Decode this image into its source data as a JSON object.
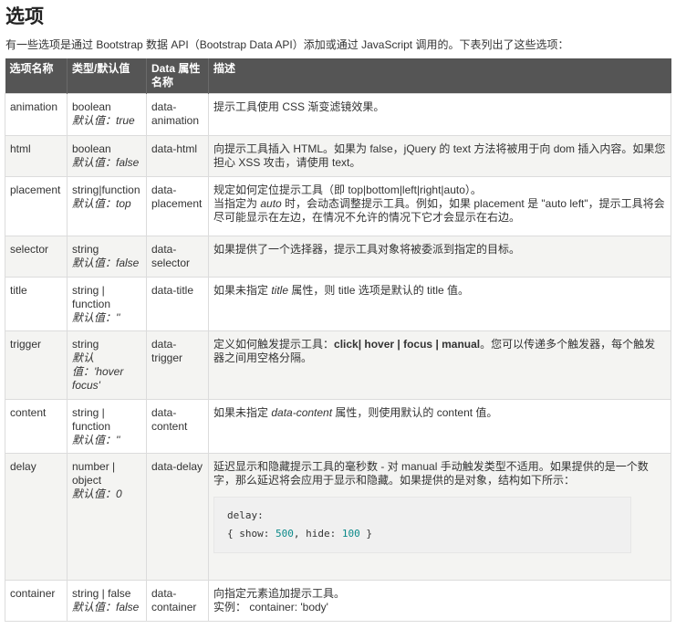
{
  "page": {
    "title": "选项",
    "intro": "有一些选项是通过 Bootstrap 数据 API（Bootstrap Data API）添加或通过 JavaScript 调用的。下表列出了这些选项："
  },
  "table": {
    "headers": [
      "选项名称",
      "类型/默认值",
      "Data 属性名称",
      "描述"
    ],
    "rows": [
      {
        "name": "animation",
        "type": "boolean",
        "default": "默认值：true",
        "attr": "data-animation",
        "desc": [
          "提示工具使用 CSS 渐变滤镜效果。"
        ]
      },
      {
        "name": "html",
        "type": "boolean",
        "default": "默认值：false",
        "attr": "data-html",
        "desc": [
          "向提示工具插入 HTML。如果为 false，jQuery 的 text 方法将被用于向 dom 插入内容。如果您担心 XSS 攻击，请使用 text。"
        ]
      },
      {
        "name": "placement",
        "type": "string|function",
        "default": "默认值：top",
        "attr": "data-placement",
        "desc_line1": "规定如何定位提示工具（即 top|bottom|left|right|auto）。",
        "desc_line2_a": "当指定为 ",
        "desc_line2_em": "auto",
        "desc_line2_b": " 时，会动态调整提示工具。例如，如果 placement 是 \"auto left\"，提示工具将会尽可能显示在左边，在情况不允许的情况下它才会显示在右边。"
      },
      {
        "name": "selector",
        "type": "string",
        "default": "默认值：false",
        "attr": "data-selector",
        "desc": [
          "如果提供了一个选择器，提示工具对象将被委派到指定的目标。"
        ]
      },
      {
        "name": "title",
        "type": "string | function",
        "default": "默认值：''",
        "attr": "data-title",
        "desc_a": "如果未指定 ",
        "desc_em": "title",
        "desc_b": " 属性，则 title 选项是默认的 title 值。"
      },
      {
        "name": "trigger",
        "type": "string",
        "default": "默认值：'hover focus'",
        "attr": "data-trigger",
        "desc_a": "定义如何触发提示工具：",
        "desc_strong": "click| hover | focus | manual",
        "desc_b": "。您可以传递多个触发器，每个触发器之间用空格分隔。"
      },
      {
        "name": "content",
        "type": "string | function",
        "default": "默认值：''",
        "attr": "data-content",
        "desc_a": "如果未指定 ",
        "desc_em": "data-content",
        "desc_b": " 属性，则使用默认的 content 值。"
      },
      {
        "name": "delay",
        "type": "number | object",
        "default": "默认值：0",
        "attr": "data-delay",
        "desc": [
          "延迟显示和隐藏提示工具的毫秒数 - 对 manual 手动触发类型不适用。如果提供的是一个数字，那么延迟将会应用于显示和隐藏。如果提供的是对象，结构如下所示："
        ],
        "code_line1": "delay:",
        "code_line2_a": "{ show: ",
        "code_show": "500",
        "code_line2_b": ", hide: ",
        "code_hide": "100",
        "code_line2_c": " }"
      },
      {
        "name": "container",
        "type": "string | false",
        "default": "默认值：false",
        "attr": "data-container",
        "desc_line1": "向指定元素追加提示工具。",
        "desc_line2": "实例： container: 'body'"
      }
    ]
  }
}
